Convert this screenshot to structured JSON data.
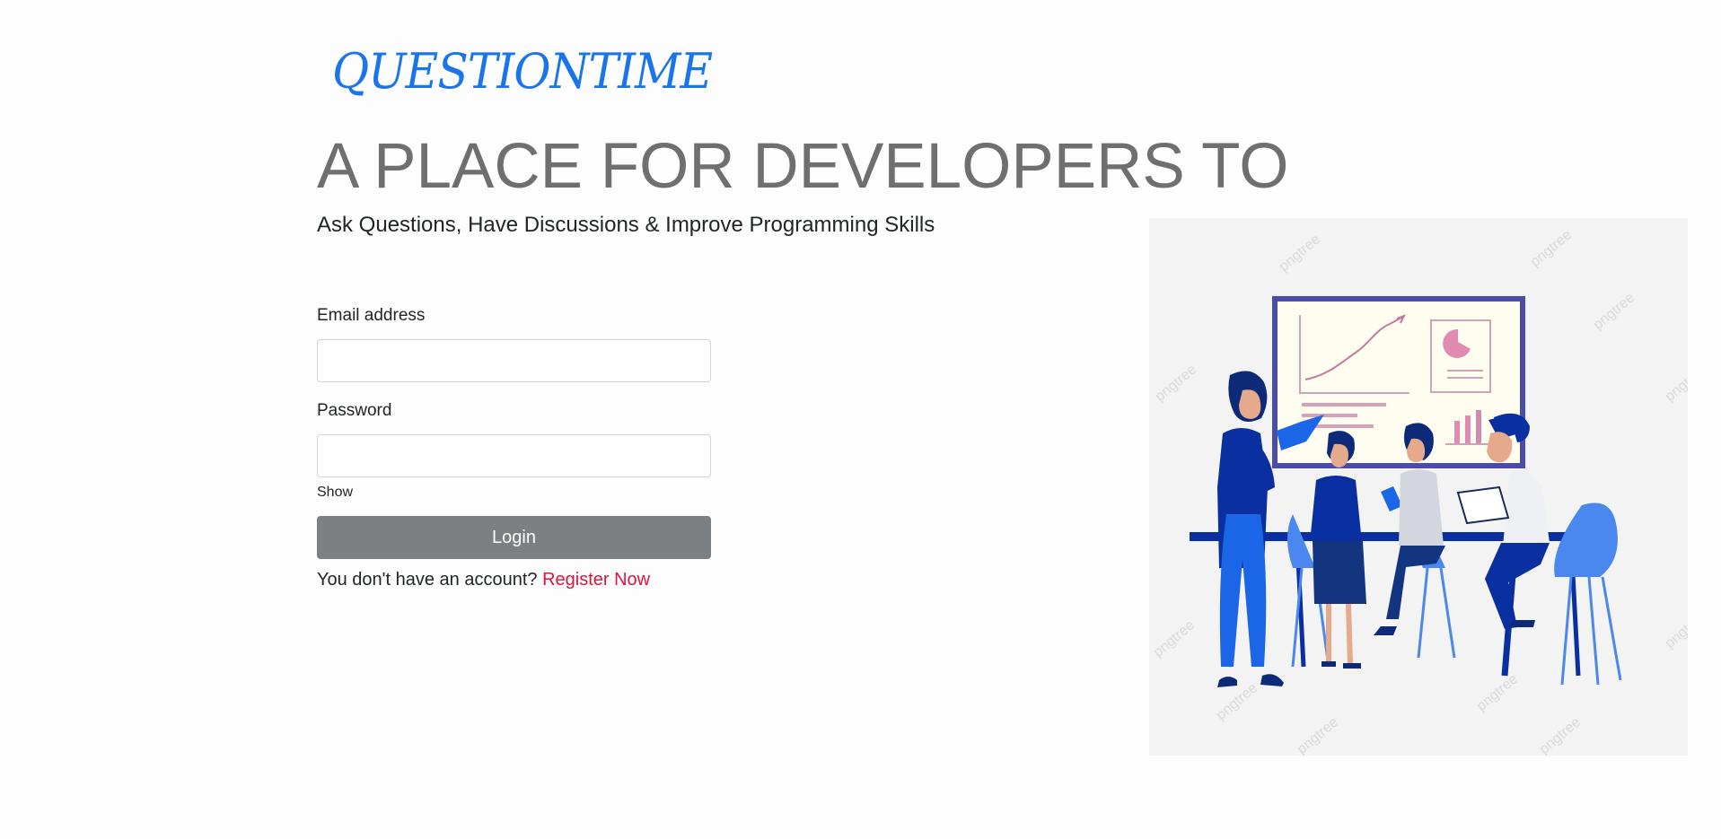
{
  "brand": {
    "logo_text": "QUESTIONTIME",
    "color": "#1a74ea"
  },
  "hero": {
    "headline": "A PLACE FOR DEVELOPERS TO",
    "subheadline": "Ask Questions, Have Discussions & Improve Programming Skills"
  },
  "login_form": {
    "email_label": "Email address",
    "email_value": "",
    "password_label": "Password",
    "password_value": "",
    "show_label": "Show",
    "submit_label": "Login",
    "register_prompt": "You don't have an account?",
    "register_link": "Register Now"
  },
  "illustration": {
    "watermark_text": "pngtree",
    "icon": "team-meeting-illustration",
    "colors": {
      "accent_blue": "#0a2fa0",
      "background": "#f3f3f3",
      "board_frame": "#4b4ba8"
    }
  }
}
